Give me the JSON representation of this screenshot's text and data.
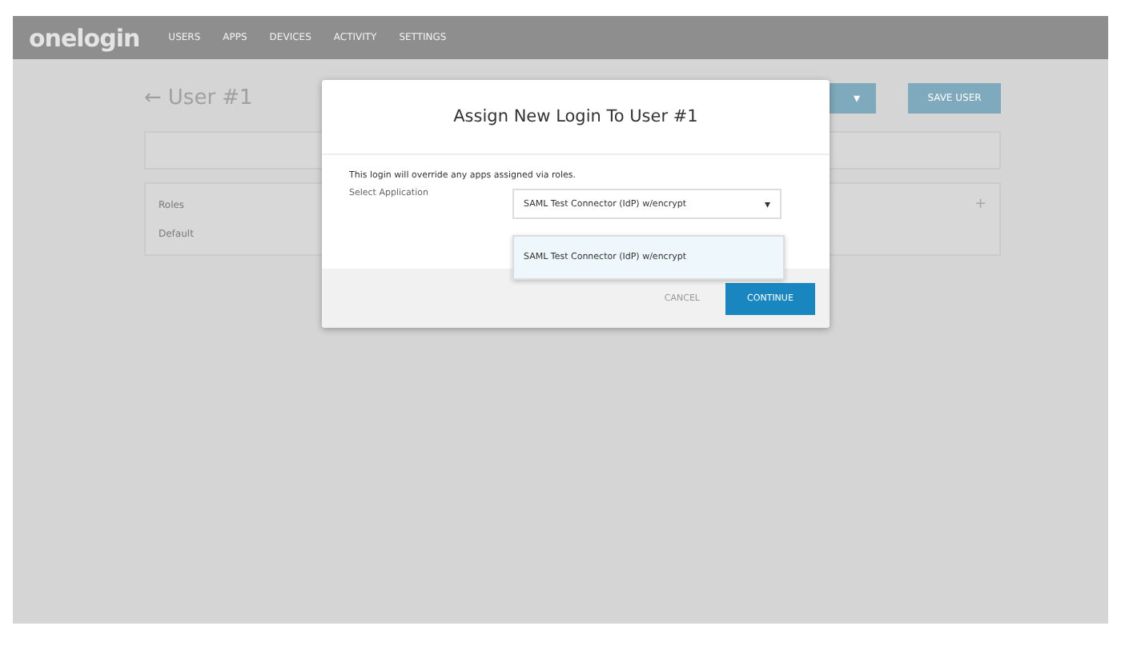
{
  "nav": {
    "logo": "onelogin",
    "items": [
      "USERS",
      "APPS",
      "DEVICES",
      "ACTIVITY",
      "SETTINGS"
    ]
  },
  "page": {
    "back_arrow": "←",
    "title": "User #1",
    "more_caret": "▾",
    "save_button": "SAVE USER",
    "roles_label": "Roles",
    "default_label": "Default",
    "add": "+"
  },
  "dialog": {
    "title": "Assign New Login To User #1",
    "message": "This login will override any apps assigned via roles.",
    "field_label": "Select Application",
    "select_value": "SAML Test Connector (IdP) w/encrypt",
    "select_arrow": "▾",
    "options": [
      {
        "label": "SAML Test Connector (IdP) w/encrypt",
        "selected": true
      }
    ],
    "cancel": "CANCEL",
    "continue": "CONTINUE"
  }
}
